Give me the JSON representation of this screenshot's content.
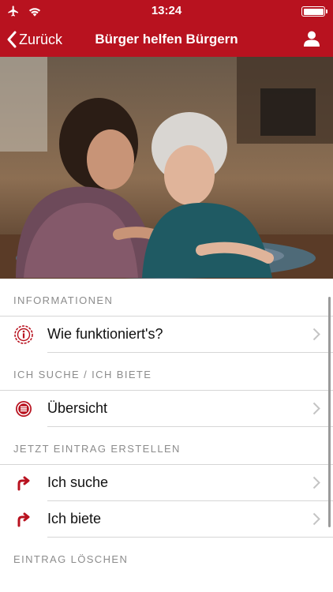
{
  "status": {
    "time": "13:24"
  },
  "nav": {
    "back_label": "Zurück",
    "title": "Bürger helfen Bürgern"
  },
  "colors": {
    "brand": "#b8121f",
    "separator": "#d6d6d6",
    "section_text": "#8c8c8c"
  },
  "sections": [
    {
      "header": "INFORMATIONEN",
      "items": [
        {
          "label": "Wie funktioniert's?",
          "icon": "info-circle-icon"
        }
      ]
    },
    {
      "header": "ICH SUCHE / ICH BIETE",
      "items": [
        {
          "label": "Übersicht",
          "icon": "list-circle-icon"
        }
      ]
    },
    {
      "header": "JETZT EINTRAG ERSTELLEN",
      "items": [
        {
          "label": "Ich suche",
          "icon": "arrow-turn-up-right-icon"
        },
        {
          "label": "Ich biete",
          "icon": "arrow-turn-up-right-icon"
        }
      ]
    },
    {
      "header": "EINTRAG LÖSCHEN",
      "items": []
    }
  ]
}
